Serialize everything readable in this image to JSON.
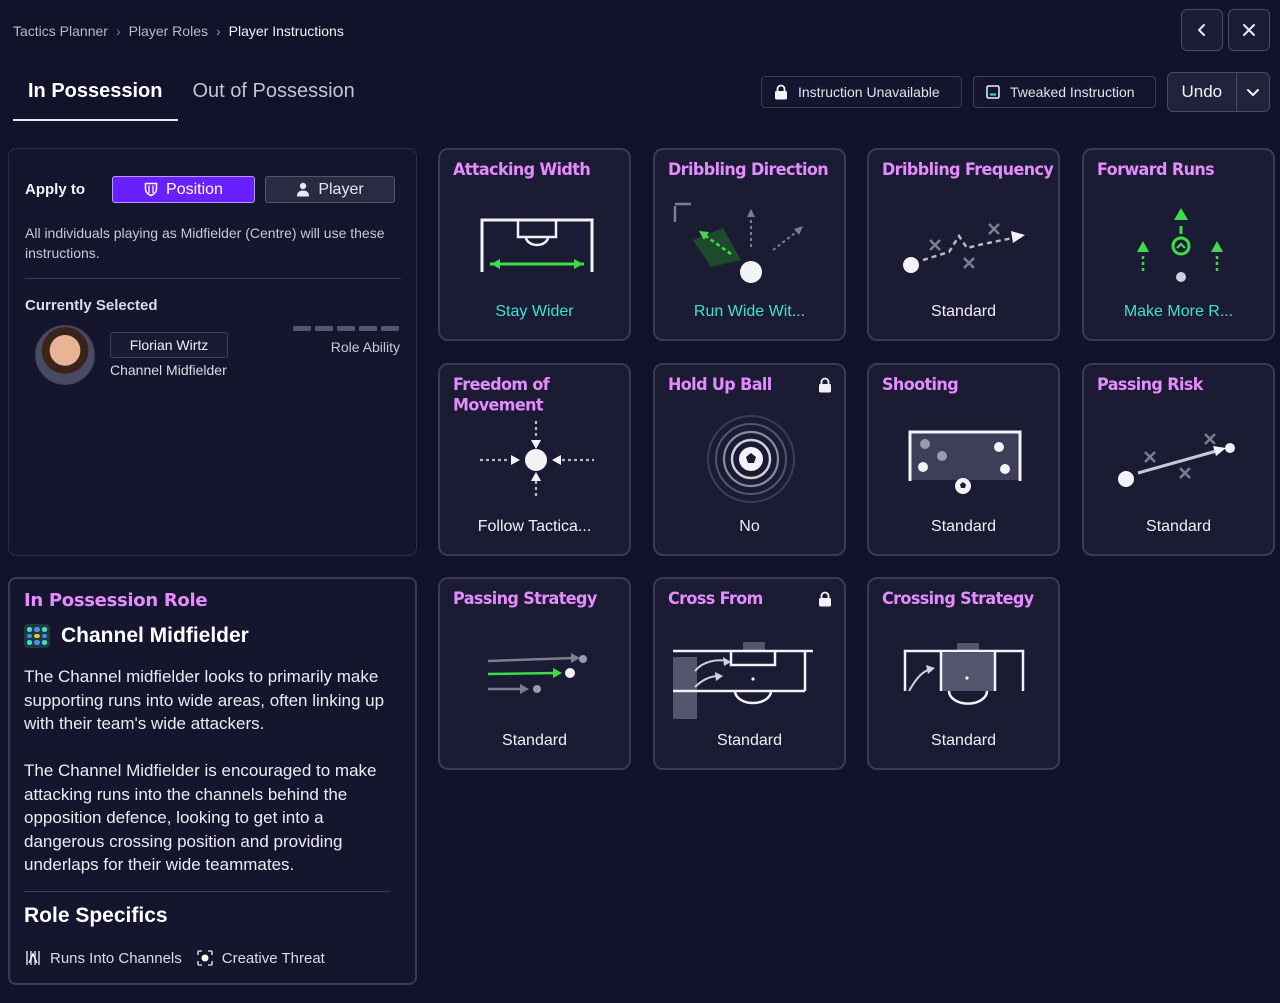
{
  "breadcrumb": [
    "Tactics Planner",
    "Player Roles",
    "Player Instructions"
  ],
  "tabs": [
    {
      "label": "In Possession",
      "active": true
    },
    {
      "label": "Out of Possession",
      "active": false
    }
  ],
  "legend": {
    "unavailable": "Instruction Unavailable",
    "tweaked": "Tweaked Instruction"
  },
  "undo_label": "Undo",
  "apply": {
    "label": "Apply to",
    "options": [
      "Position",
      "Player"
    ],
    "selected": "Position",
    "description": "All individuals playing as Midfielder (Centre) will use these instructions."
  },
  "current": {
    "title": "Currently Selected",
    "player_name": "Florian Wirtz",
    "player_role": "Channel Midfielder",
    "ability_label": "Role Ability"
  },
  "role_panel": {
    "heading": "In Possession Role",
    "role_name": "Channel Midfielder",
    "desc1": "The Channel midfielder looks to primarily make supporting runs into wide areas, often linking up with their team's wide attackers.",
    "desc2": "The Channel Midfielder is encouraged to make attacking runs into the channels behind the opposition defence, looking to get into a dangerous crossing position and providing underlaps for their wide teammates.",
    "specifics_title": "Role Specifics",
    "specifics": [
      "Runs Into Channels",
      "Creative Threat"
    ]
  },
  "instructions": [
    {
      "title": "Attacking Width",
      "value": "Stay Wider",
      "changed": true,
      "locked": false
    },
    {
      "title": "Dribbling Direction",
      "value": "Run Wide Wit...",
      "changed": true,
      "locked": false
    },
    {
      "title": "Dribbling Frequency",
      "value": "Standard",
      "changed": false,
      "locked": false
    },
    {
      "title": "Forward Runs",
      "value": "Make More R...",
      "changed": true,
      "locked": false
    },
    {
      "title": "Freedom of Movement",
      "value": "Follow Tactica...",
      "changed": false,
      "locked": false
    },
    {
      "title": "Hold Up Ball",
      "value": "No",
      "changed": false,
      "locked": true
    },
    {
      "title": "Shooting",
      "value": "Standard",
      "changed": false,
      "locked": false
    },
    {
      "title": "Passing Risk",
      "value": "Standard",
      "changed": false,
      "locked": false
    },
    {
      "title": "Passing Strategy",
      "value": "Standard",
      "changed": false,
      "locked": false
    },
    {
      "title": "Cross From",
      "value": "Standard",
      "changed": false,
      "locked": true
    },
    {
      "title": "Crossing Strategy",
      "value": "Standard",
      "changed": false,
      "locked": false
    }
  ],
  "colors": {
    "accent_purple": "#6a1fff",
    "title_pink": "#e58cff",
    "changed_teal": "#3ee0d6",
    "arrow_green": "#3ddc4a"
  }
}
